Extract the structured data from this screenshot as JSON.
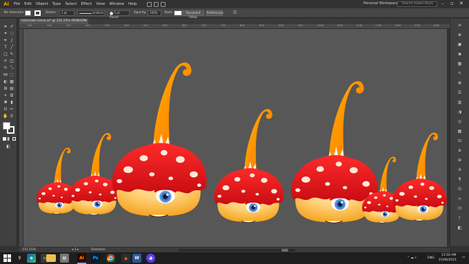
{
  "menu": {
    "logo": "Ai",
    "items": [
      "File",
      "Edit",
      "Object",
      "Type",
      "Select",
      "Effect",
      "View",
      "Window",
      "Help"
    ],
    "workspace": "Personal Workspace",
    "search_placeholder": "Search Adobe Stock"
  },
  "control_bar": {
    "selection_label": "No Selection",
    "stroke_label": "Stroke:",
    "stroke_weight": "1 pt",
    "profile": "Uniform",
    "brush": "5 pt. Round",
    "opacity_label": "Opacity:",
    "opacity_value": "100%",
    "style_label": "Style:",
    "doc_setup": "Document Setup",
    "preferences": "Preferences"
  },
  "document": {
    "tab_title": "Interview scene.ai* @ 131.15% (RGB/GPU Preview)",
    "ruler_ticks": [
      "250",
      "300",
      "350",
      "400",
      "450",
      "500",
      "550",
      "600",
      "650",
      "700",
      "750",
      "800",
      "850",
      "900",
      "950",
      "1000",
      "1050",
      "1100",
      "1150",
      "1200",
      "1250",
      "1300"
    ]
  },
  "status": {
    "zoom": "131.15%",
    "mode": "Selection"
  },
  "taskbar": {
    "time": "11:50 AM",
    "date": "21/06/2021",
    "lang": "ENG",
    "ai_label": "Ai",
    "ps_label": "Ps"
  },
  "colors": {
    "cap_red": "#e0141a",
    "cap_dark": "#b50c12",
    "stem_orange": "#ff8a00",
    "body_light": "#ffd27a",
    "body_dark": "#f5a623",
    "iris": "#3e78c9",
    "canvas": "#575757"
  }
}
